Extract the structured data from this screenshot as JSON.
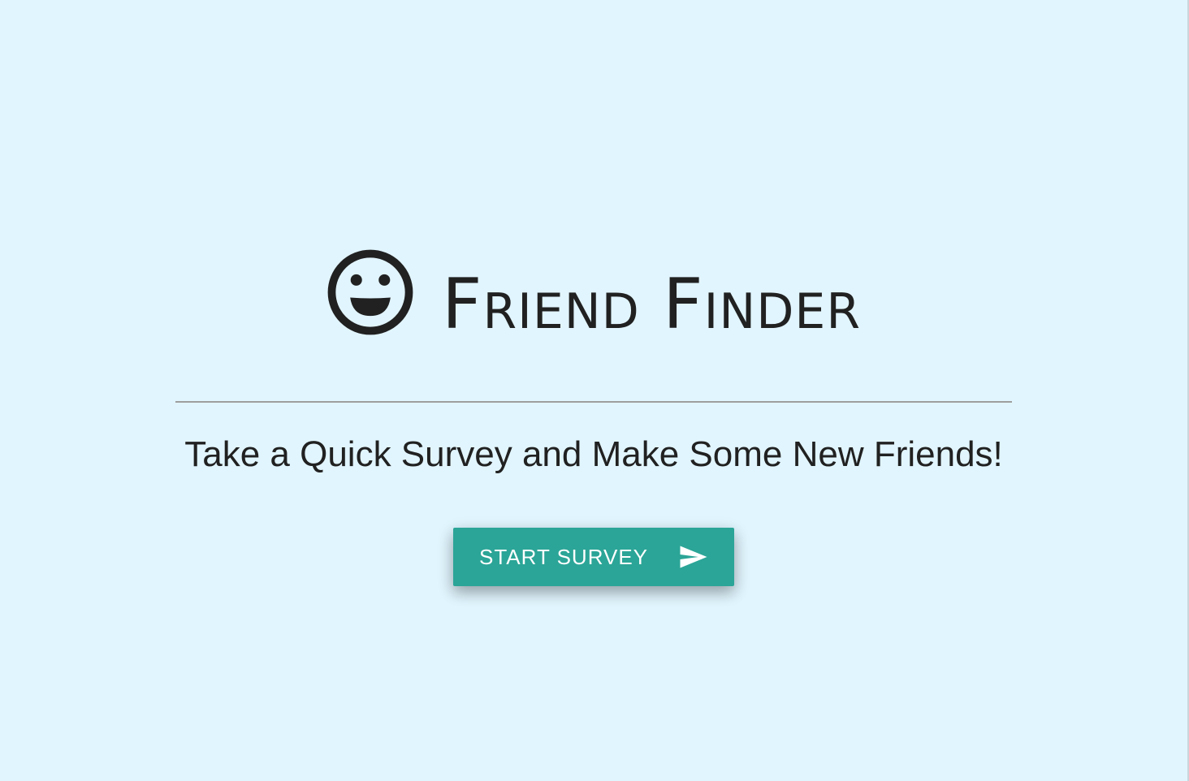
{
  "header": {
    "title": "Friend Finder",
    "icon": "smiley-face-icon"
  },
  "main": {
    "subtitle": "Take a Quick Survey and Make Some New Friends!",
    "start_button": {
      "label": "START SURVEY",
      "icon": "send-icon"
    }
  },
  "colors": {
    "background": "#e1f5fe",
    "button": "#2ba597",
    "text": "#212121",
    "divider": "#9e9e9e"
  }
}
